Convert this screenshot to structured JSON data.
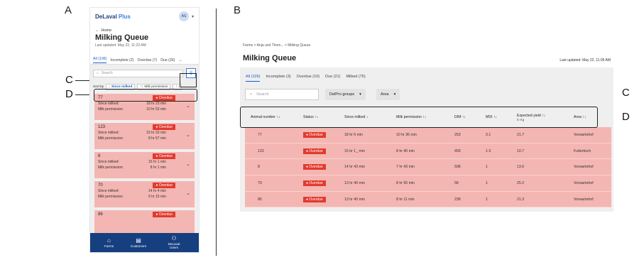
{
  "figure": {
    "panel_a": "A",
    "panel_b": "B",
    "callout_c": "C",
    "callout_d": "D"
  },
  "mobile": {
    "brand": "DeLaval",
    "brand_plus": "Plus",
    "avatar": "AS",
    "back": "Home",
    "title": "Milking Queue",
    "updated": "Last updated: May 22, 11:23 AM",
    "tabs": [
      {
        "label": "All (106)",
        "active": true
      },
      {
        "label": "Incomplete (2)"
      },
      {
        "label": "Overdue (7)"
      },
      {
        "label": "Due (26)"
      }
    ],
    "search_placeholder": "Search",
    "sort_label": "Sort by",
    "sort_chips": [
      {
        "label": "Since milked",
        "active": true
      },
      {
        "label": "Milk permission"
      }
    ],
    "status_badge": "Overdue",
    "since_label": "Since milked:",
    "perm_label": "Milk permission:",
    "cards": [
      {
        "id": "77",
        "since": "18 hr 23 min",
        "perm": "10 hr 53 min"
      },
      {
        "id": "123",
        "since": "15 hr 33 min",
        "perm": "8 hr 57 min"
      },
      {
        "id": "8",
        "since": "15 hr 1 min",
        "perm": "8 hr 1 min"
      },
      {
        "id": "70",
        "since": "14 hr 4 min",
        "perm": "5 hr 15 min"
      },
      {
        "id": "86"
      }
    ],
    "nav": [
      {
        "label": "Farms",
        "icon": "farm-icon"
      },
      {
        "label": "Customers",
        "icon": "customers-icon"
      },
      {
        "label": "DeLaval Users",
        "icon": "users-icon"
      }
    ]
  },
  "desktop": {
    "breadcrumb": "Farms  >  Anja und Thom...  >  Milking Queue",
    "title": "Milking Queue",
    "updated": "Last updated: May 22, 11:05 AM",
    "tabs": [
      {
        "label": "All (105)",
        "active": true
      },
      {
        "label": "Incomplete (3)"
      },
      {
        "label": "Overdue (10)"
      },
      {
        "label": "Due (21)"
      },
      {
        "label": "Milked (76)"
      }
    ],
    "search_placeholder": "Search",
    "dropdown_groups": "DelPro groups",
    "dropdown_area": "Area",
    "columns": [
      "Animal number",
      "Status",
      "Since milked",
      "Milk permission",
      "DIM",
      "MDI",
      "Expected yield",
      "Area"
    ],
    "expected_yield_unit": "in Kg",
    "status_badge": "Overdue",
    "rows": [
      {
        "animal": "77",
        "since": "18 hr 6 min",
        "perm": "10 hr 36 min",
        "dim": "253",
        "mdi": "3.1",
        "yield": "21.7",
        "area": "Vorwartehof"
      },
      {
        "animal": "123",
        "since": "15 hr 1_ min",
        "perm": "8 hr 40 min",
        "dim": "459",
        "mdi": "1.3",
        "yield": "10.7",
        "area": "Futtertisch"
      },
      {
        "animal": "8",
        "since": "14 hr 43 min",
        "perm": "7 hr 43 min",
        "dim": "598",
        "mdi": "1",
        "yield": "13.6",
        "area": "Vorwartehof"
      },
      {
        "animal": "70",
        "since": "13 hr 40 min",
        "perm": "8 hr 55 min",
        "dim": "58",
        "mdi": "1",
        "yield": "25.2",
        "area": "Vorwartehof"
      },
      {
        "animal": "86",
        "since": "13 hr 40 min",
        "perm": "8 hr 11 min",
        "dim": "238",
        "mdi": "1",
        "yield": "21.3",
        "area": "Vorwartehof"
      }
    ]
  },
  "colors": {
    "overdue_row": "#f4b6b2",
    "overdue_badge": "#e23a2f",
    "accent": "#1e5ac8",
    "nav_bg": "#163f80"
  }
}
